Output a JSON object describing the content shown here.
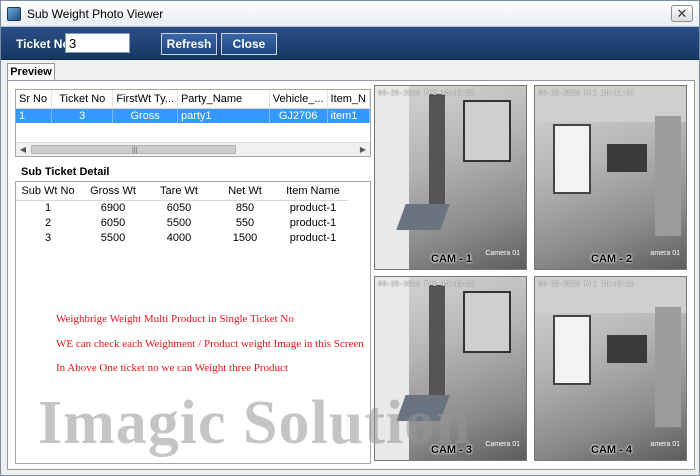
{
  "window": {
    "title": "Sub Weight Photo Viewer",
    "close_glyph": "✕"
  },
  "toolbar": {
    "ticket_label": "Ticket No",
    "ticket_value": "3",
    "refresh_label": "Refresh",
    "close_label": "Close"
  },
  "tabs": [
    {
      "label": "Preview",
      "active": true
    }
  ],
  "ticket_grid": {
    "columns": [
      "Sr No",
      "Ticket No",
      "FirstWt Ty...",
      "Party_Name",
      "Vehicle_...",
      "Item_N"
    ],
    "rows": [
      [
        "1",
        "3",
        "Gross",
        "party1",
        "GJ2706",
        "item1"
      ]
    ],
    "selected_row": 0
  },
  "sub_ticket": {
    "heading": "Sub Ticket Detail",
    "columns": [
      "Sub Wt No",
      "Gross Wt",
      "Tare Wt",
      "Net Wt",
      "Item Name"
    ],
    "rows": [
      [
        "1",
        "6900",
        "6050",
        "850",
        "product-1"
      ],
      [
        "2",
        "6050",
        "5500",
        "550",
        "product-1"
      ],
      [
        "3",
        "5500",
        "4000",
        "1500",
        "product-1"
      ]
    ]
  },
  "promo_lines": [
    "Weighbrige Weight Multi Product in Single Ticket No",
    "WE can check each Weighment / Product weight Image in this Screen",
    "In Above One ticket no we can Weight three Product"
  ],
  "watermark": "Imagic Solution",
  "cameras": [
    {
      "label": "CAM - 1",
      "timestamp": "06-28-2019 Fri 16:43:23",
      "caption": "Camera 01"
    },
    {
      "label": "CAM - 2",
      "timestamp": "06-28-2019 Fri 16:41:37",
      "caption": "amera 01"
    },
    {
      "label": "CAM - 3",
      "timestamp": "06-28-2019 Fri 16:43:23",
      "caption": "Camera 01"
    },
    {
      "label": "CAM - 4",
      "timestamp": "06-28-2019 Fri 16:43:24",
      "caption": "amera 01"
    }
  ],
  "colors": {
    "toolbar_bg": "#1d4680",
    "selection": "#3399ff",
    "promo_text": "#e8141e"
  }
}
